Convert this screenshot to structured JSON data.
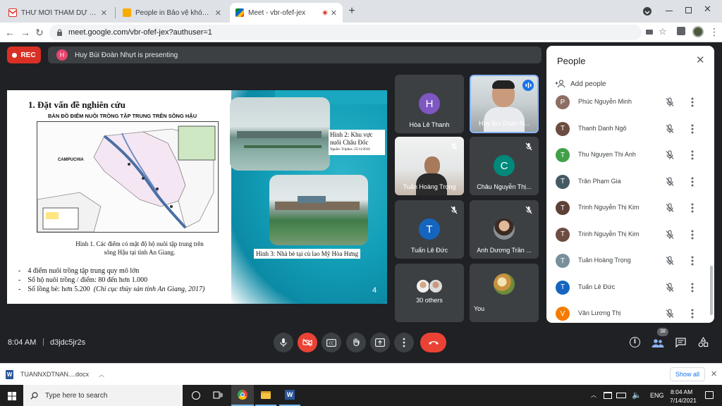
{
  "tabs": [
    {
      "title": "THƯ MỜI THAM DỰ BUỔI BẢO V",
      "icon": "gmail-icon"
    },
    {
      "title": "People in Bảo vệ khóa luận tốt n",
      "icon": "classroom-icon"
    },
    {
      "title": "Meet - vbr-ofef-jex",
      "icon": "meet-icon"
    }
  ],
  "new_tab": "+",
  "address": "meet.google.com/vbr-ofef-jex?authuser=1",
  "rec_label": "REC",
  "presenter": {
    "initial": "H",
    "text": "Huy Bùi Đoàn Nhựt is presenting",
    "color": "#e8436d"
  },
  "slide": {
    "heading": "1. Đặt vấn đề nghiên cứu",
    "map_title": "BẢN ĐỒ ĐIỂM NUÔI TRỒNG TẬP TRUNG TRÊN SÔNG HẬU",
    "map_label": "CAMPUCHIA",
    "caption1": "Hình 1. Các điểm có mật độ hộ nuôi tập trung trên sông Hậu tại tỉnh An Giang.",
    "caption2_line1": "Hình 2: Khu vực",
    "caption2_line2": "nuôi Châu Đốc",
    "caption2_src": "Nguồn: Triphuc, 25/11/2016",
    "caption3": "Hình 3: Nhà bè tại cù lao Mỹ Hòa Hưng",
    "bullets": [
      "4 điểm nuôi trồng tập trung quy mô lớn",
      "Số hộ nuôi trồng / điểm: 80 đến hơn 1.000",
      "Số lồng bè: hơn 5.200"
    ],
    "bullet3_note": "(Chi cục thủy sản tỉnh An Giang, 2017)",
    "page_number": "4"
  },
  "tiles": [
    {
      "name": "Hòa Lê Thanh",
      "initial": "H",
      "color": "#7e57c2",
      "type": "avatar",
      "muted": false
    },
    {
      "name": "Huy Bùi Đoàn N...",
      "type": "video",
      "muted": false,
      "speaking": true
    },
    {
      "name": "Tuấn Hoàng Trọng",
      "type": "video",
      "muted": true
    },
    {
      "name": "Châu Nguyễn Thị...",
      "initial": "C",
      "color": "#00897b",
      "type": "avatar",
      "muted": true
    },
    {
      "name": "Tuấn Lê Đức",
      "initial": "T",
      "color": "#1565c0",
      "type": "avatar",
      "muted": true
    },
    {
      "name": "Anh Dương Trần ...",
      "type": "photo",
      "muted": true
    },
    {
      "name": "30 others",
      "type": "others"
    },
    {
      "name": "You",
      "type": "photo"
    }
  ],
  "people_panel": {
    "title": "People",
    "add_label": "Add people",
    "rows": [
      {
        "name": "Phúc Nguyễn Minh",
        "initial": "P",
        "color": "#8d6e63"
      },
      {
        "name": "Thanh Danh Ngô",
        "initial": "T",
        "color": "#6d4c41"
      },
      {
        "name": "Thu Nguyen Thi Anh",
        "initial": "T",
        "color": "#43a047"
      },
      {
        "name": "Trân Phạm Gia",
        "initial": "T",
        "color": "#455a64"
      },
      {
        "name": "Trinh Nguyễn Thị Kim",
        "initial": "T",
        "color": "#5d4037"
      },
      {
        "name": "Trinh Nguyễn Thị Kim",
        "initial": "T",
        "color": "#6d4c41"
      },
      {
        "name": "Tuân Hoàng Trọng",
        "initial": "T",
        "color": "#78909c"
      },
      {
        "name": "Tuấn Lê Đức",
        "initial": "T",
        "color": "#1565c0"
      },
      {
        "name": "Vân Lương Thị",
        "initial": "V",
        "color": "#f57c00"
      }
    ]
  },
  "bottom": {
    "time": "8:04 AM",
    "divider": "|",
    "code": "d3jdc5jr2s",
    "participant_count": "38"
  },
  "download": {
    "file": "TUANNXDTNAN....docx",
    "show_all": "Show all"
  },
  "taskbar": {
    "search": "Type here to search",
    "time": "8:04 AM",
    "date": "7/14/2021",
    "lang": "ENG"
  }
}
